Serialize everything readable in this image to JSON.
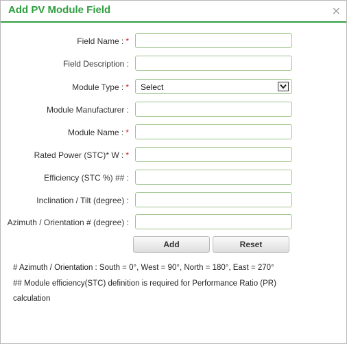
{
  "dialog": {
    "title": "Add PV Module Field",
    "close_glyph": "×"
  },
  "fields": [
    {
      "label": "Field Name :",
      "required": "*",
      "value": "",
      "type": "text"
    },
    {
      "label": "Field Description :",
      "required": "",
      "value": "",
      "type": "text"
    },
    {
      "label": "Module Type :",
      "required": "*",
      "value": "Select",
      "type": "select"
    },
    {
      "label": "Module Manufacturer :",
      "required": "",
      "value": "",
      "type": "text"
    },
    {
      "label": "Module Name :",
      "required": "*",
      "value": "",
      "type": "text"
    },
    {
      "label": "Rated Power (STC)* W :",
      "required": "*",
      "value": "",
      "type": "text"
    },
    {
      "label": "Efficiency (STC %) ## :",
      "required": "",
      "value": "",
      "type": "text"
    },
    {
      "label": "Inclination / Tilt (degree) :",
      "required": "",
      "value": "",
      "type": "text"
    },
    {
      "label": "Azimuth / Orientation # (degree) :",
      "required": "",
      "value": "",
      "type": "text"
    }
  ],
  "buttons": {
    "add_label": "Add",
    "reset_label": "Reset"
  },
  "notes": [
    "# Azimuth / Orientation : South = 0°, West = 90°, North = 180°, East = 270°",
    "## Module efficiency(STC) definition is required for Performance Ratio (PR)",
    "calculation"
  ],
  "icons": {
    "close": "close-icon",
    "dropdown": "chevron-down-icon"
  },
  "colors": {
    "title": "#2e9e3f",
    "input_border": "#9dc48c",
    "required": "#d62020"
  }
}
